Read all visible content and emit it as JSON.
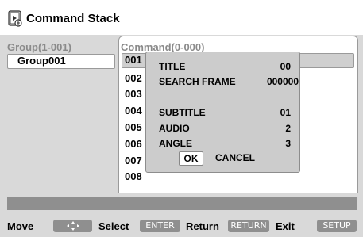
{
  "title": "Command Stack",
  "icon": "command-stack-icon",
  "group_header": "Group(1-001)",
  "group_items": [
    "Group001"
  ],
  "command_header": "Command(0-000)",
  "command_numbers": [
    "001",
    "002",
    "003",
    "004",
    "005",
    "006",
    "007",
    "008"
  ],
  "popup": {
    "title_label": "TITLE",
    "title_value": "00",
    "search_label": "SEARCH FRAME",
    "search_value": "000000",
    "subtitle_label": "SUBTITLE",
    "subtitle_value": "01",
    "audio_label": "AUDIO",
    "audio_value": "2",
    "angle_label": "ANGLE",
    "angle_value": "3",
    "ok_label": "OK",
    "cancel_label": "CANCEL"
  },
  "footer": {
    "move_label": "Move",
    "select_label": "Select",
    "select_key": "ENTER",
    "return_label": "Return",
    "return_key": "RETURN",
    "exit_label": "Exit",
    "exit_key": "SETUP"
  }
}
